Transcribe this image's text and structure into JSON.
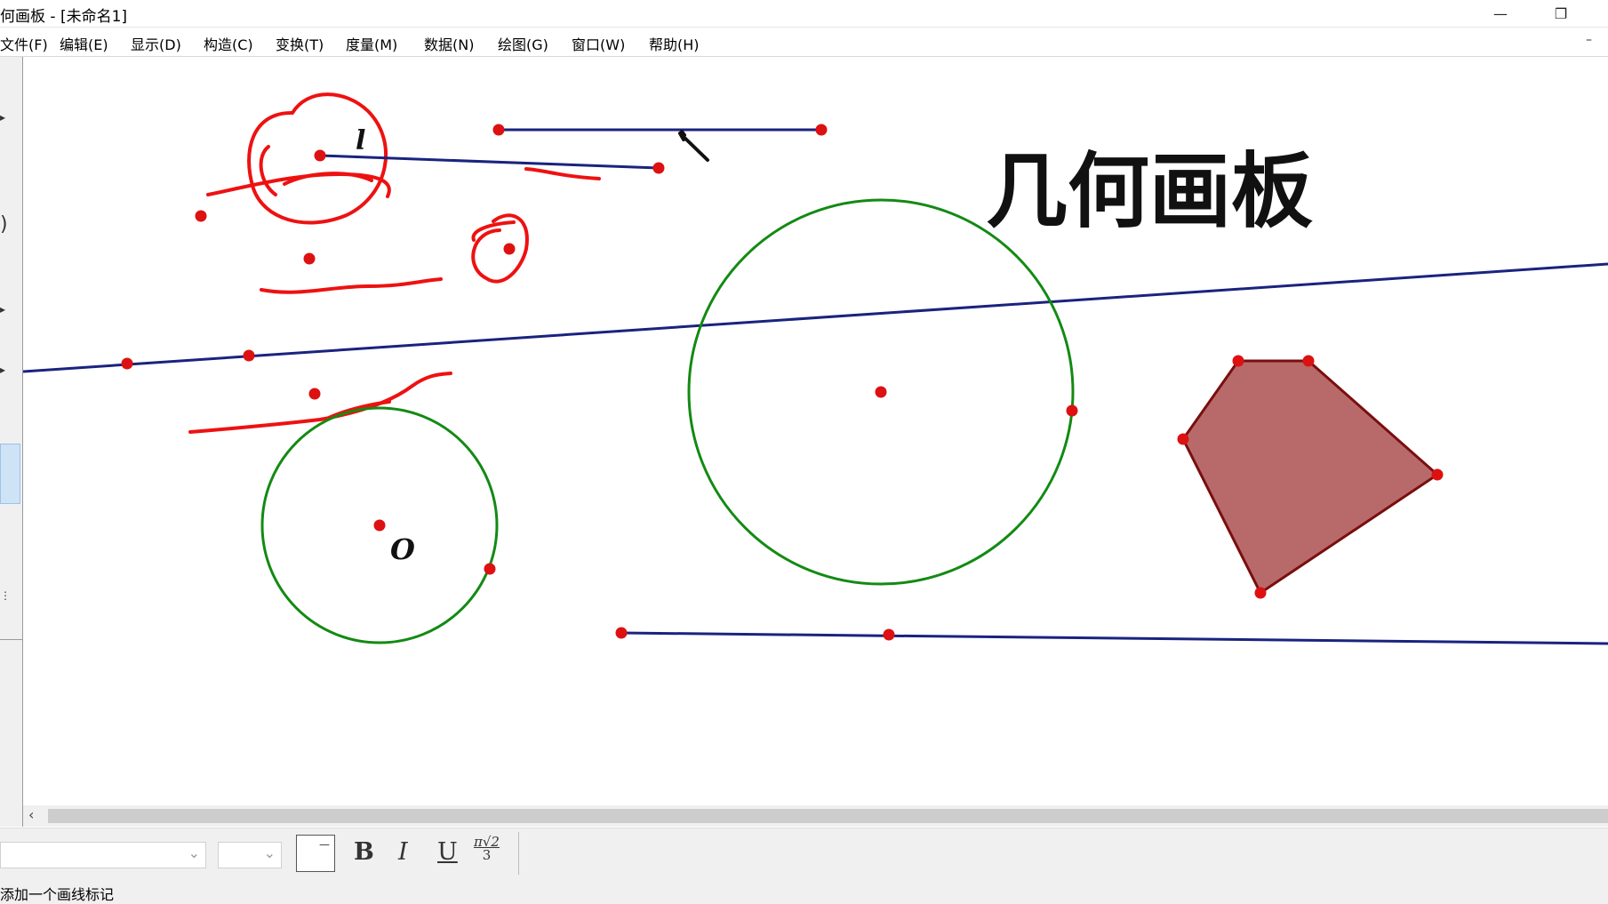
{
  "window": {
    "title": "何画板 - [未命名1]",
    "minimize_glyph": "—",
    "restore_glyph": "❐"
  },
  "menu": {
    "items": [
      "文件(F)",
      "编辑(E)",
      "显示(D)",
      "构造(C)",
      "变换(T)",
      "度量(M)",
      "数据(N)",
      "绘图(G)",
      "窗口(W)",
      "帮助(H)"
    ],
    "doc_min_glyph": "–"
  },
  "canvas": {
    "title_text": "几何画板",
    "labels": {
      "segment_label": "l",
      "circle_center_label": "O"
    },
    "colors": {
      "point": "#dd1111",
      "line": "#1a237e",
      "circle": "#138a13",
      "polygon_fill": "#b86a6a",
      "polygon_stroke": "#7a0e0e",
      "pen_mark": "#ee1111"
    }
  },
  "format_bar": {
    "bold": "B",
    "italic": "I",
    "underline": "U",
    "frac_num": "π√2",
    "frac_den": "3",
    "color_dash": "—",
    "chevron": "⌄"
  },
  "scroll": {
    "left_arrow": "‹"
  },
  "status": {
    "text": "添加一个画线标记"
  }
}
